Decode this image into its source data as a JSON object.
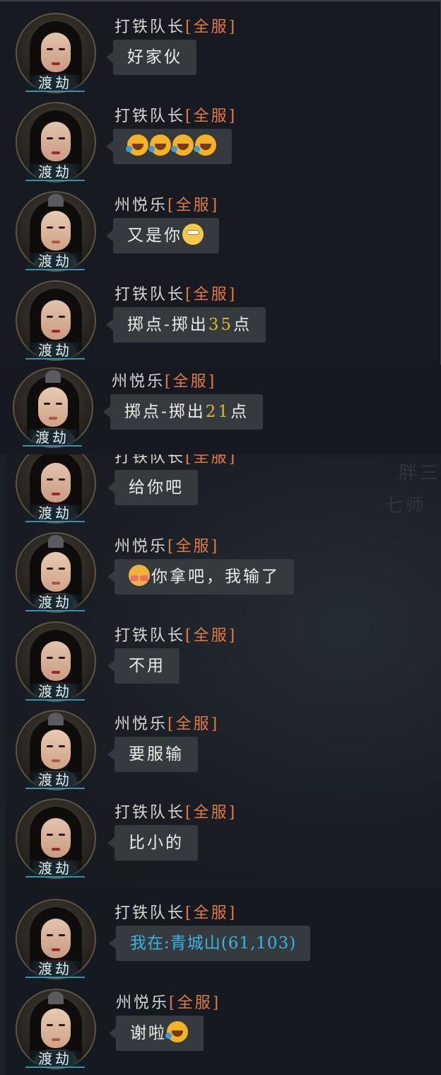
{
  "player_tag": "渡劫",
  "server_tag": "[全服]",
  "background_text": [
    "胖三",
    "七师"
  ],
  "colors": {
    "server_tag": "#e07a42",
    "number": "#e0b526",
    "location": "#3cb4e0",
    "bubble": "#343a3e",
    "name": "#d7d7d2"
  },
  "messages": [
    {
      "sender": "打铁队长",
      "text": "好家伙",
      "emoji": "",
      "emoji_count": 0
    },
    {
      "sender": "打铁队长",
      "text": "",
      "emoji": "rofl-emoji",
      "emoji_count": 4
    },
    {
      "sender": "州悦乐",
      "text": "又是你",
      "emoji": "eye-roll-emoji",
      "emoji_count": 1
    },
    {
      "sender": "打铁队长",
      "text_pre": "掷点-掷出",
      "number": "35",
      "text_post": "点"
    },
    {
      "sender": "州悦乐",
      "text_pre": "掷点-掷出",
      "number": "21",
      "text_post": "点"
    },
    {
      "sender": "打铁队长",
      "text": "给你吧"
    },
    {
      "sender": "州悦乐",
      "text": "你拿吧，我输了",
      "emoji": "flushed-emoji",
      "emoji_count": 1
    },
    {
      "sender": "打铁队长",
      "text": "不用"
    },
    {
      "sender": "州悦乐",
      "text": "要服输"
    },
    {
      "sender": "打铁队长",
      "text": "比小的"
    },
    {
      "sender": "打铁队长",
      "location": "我在:青城山(61,103)"
    },
    {
      "sender": "州悦乐",
      "text": "谢啦",
      "emoji": "rofl-emoji",
      "emoji_count": 1
    }
  ]
}
